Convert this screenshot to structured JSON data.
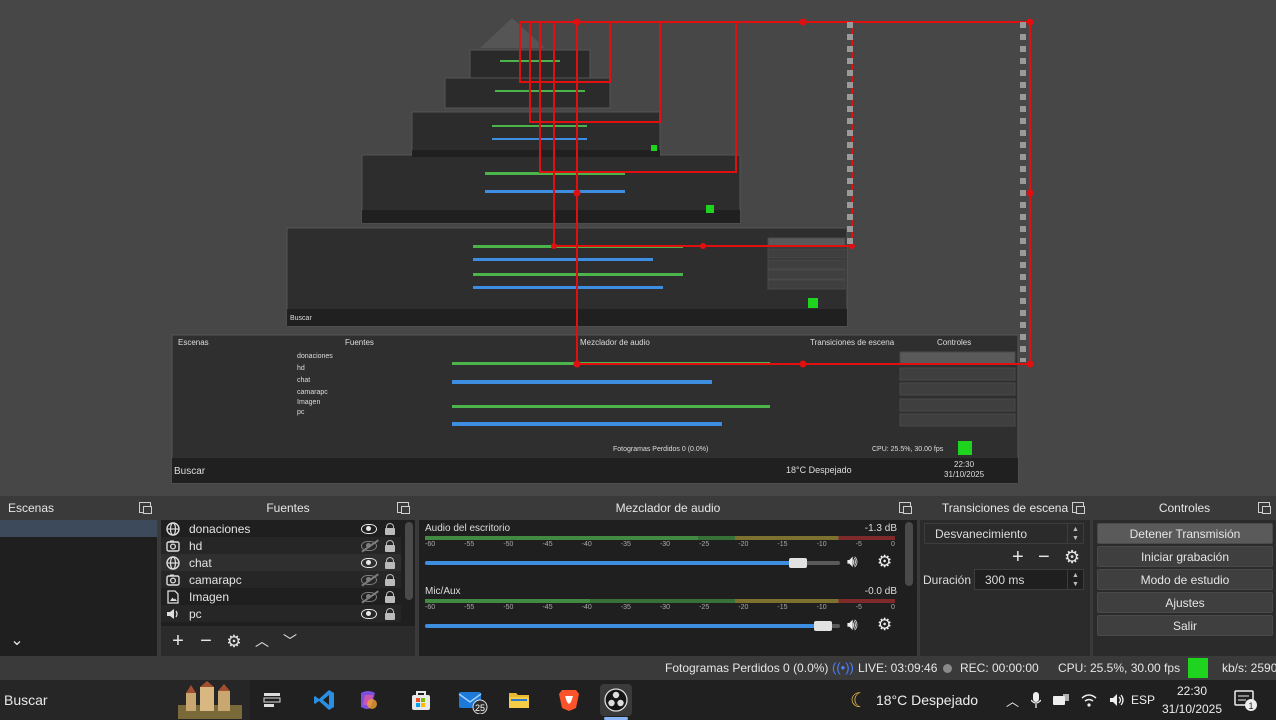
{
  "docks": {
    "scenes": {
      "title": "Escenas"
    },
    "sources": {
      "title": "Fuentes",
      "items": [
        {
          "name": "donaciones",
          "icon": "globe-icon",
          "visible": true
        },
        {
          "name": "hd",
          "icon": "camera-icon",
          "visible": false
        },
        {
          "name": "chat",
          "icon": "globe-icon",
          "visible": true
        },
        {
          "name": "camarapc",
          "icon": "camera-icon",
          "visible": false
        },
        {
          "name": "Imagen",
          "icon": "image-icon",
          "visible": false
        },
        {
          "name": "pc",
          "icon": "speaker-icon",
          "visible": true
        }
      ]
    },
    "mixer": {
      "title": "Mezclador de audio",
      "channels": [
        {
          "name": "Audio del escritorio",
          "db": "-1.3 dB",
          "level": 0.58,
          "volume": 0.92
        },
        {
          "name": "Mic/Aux",
          "db": "-0.0 dB",
          "level": 0.35,
          "volume": 0.98
        }
      ],
      "scale": [
        "-60",
        "-55",
        "-50",
        "-45",
        "-40",
        "-35",
        "-30",
        "-25",
        "-20",
        "-15",
        "-10",
        "-5",
        "0"
      ]
    },
    "transitions": {
      "title": "Transiciones de escena",
      "selected": "Desvanecimiento",
      "duration_label": "Duración",
      "duration_value": "300 ms"
    },
    "controls": {
      "title": "Controles",
      "buttons": [
        "Detener Transmisión",
        "Iniciar grabación",
        "Modo de estudio",
        "Ajustes",
        "Salir"
      ]
    }
  },
  "status": {
    "dropped": "Fotogramas Perdidos 0 (0.0%)",
    "live": "LIVE: 03:09:46",
    "rec": "REC: 00:00:00",
    "cpu": "CPU: 25.5%, 30.00 fps",
    "kbps": "kb/s: 2590"
  },
  "taskbar": {
    "search": "Buscar",
    "weather": "18°C  Despejado",
    "lang": "ESP",
    "time": "22:30",
    "date": "31/10/2025",
    "mail_badge": "25",
    "notif_badge": "1"
  },
  "colors": {
    "accent": "#3d8de0",
    "live_indicator": "#1ed41e",
    "bounding_box": "#e01010"
  }
}
